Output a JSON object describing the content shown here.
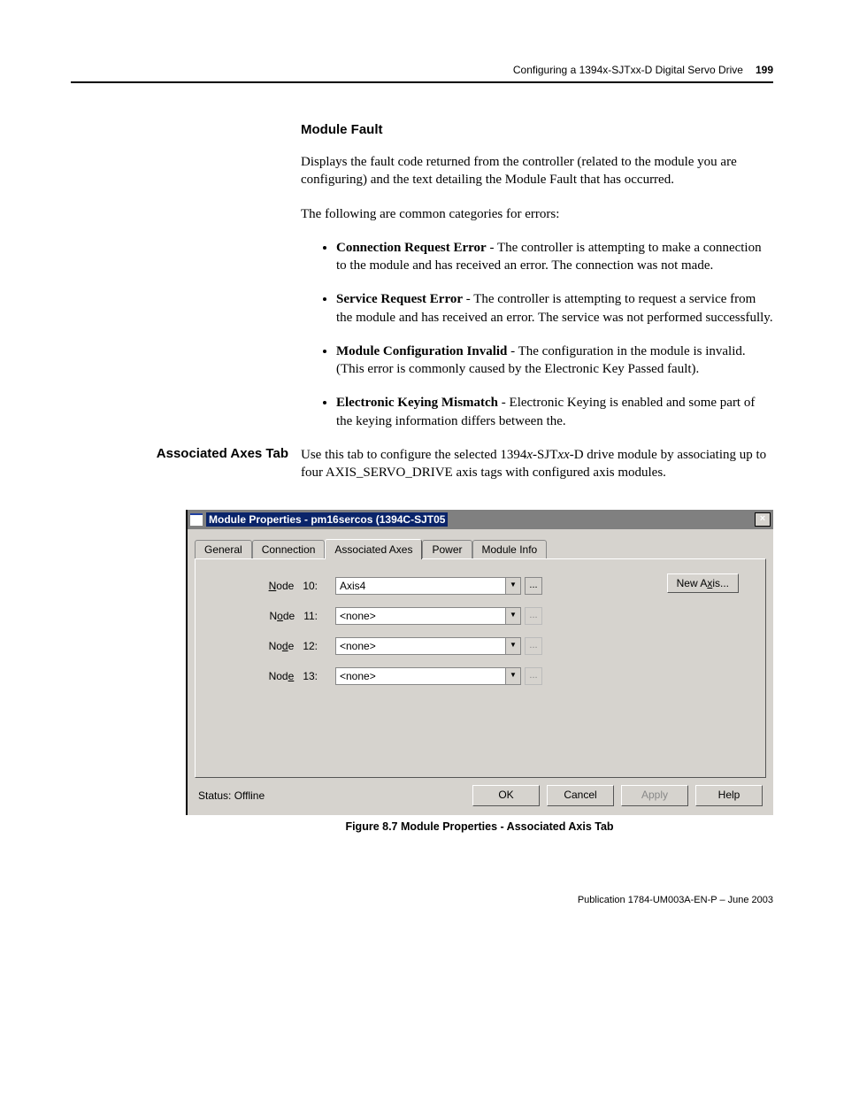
{
  "header": {
    "title": "Configuring a 1394x-SJTxx-D Digital Servo Drive",
    "pagenum": "199"
  },
  "section1": {
    "title": "Module Fault",
    "p1": "Displays the fault code returned from the controller (related to the module you are configuring) and the text detailing the Module Fault that has occurred.",
    "p2": "The following are common categories for errors:",
    "items": [
      {
        "term": "Connection Request Error",
        "desc": " - The controller is attempting to make a connection to the module and has received an error. The connection was not made."
      },
      {
        "term": "Service Request Error",
        "desc": " - The controller is attempting to request a service from the module and has received an error. The service was not performed successfully."
      },
      {
        "term": "Module Configuration Invalid",
        "desc": " - The configuration in the module is invalid. (This error is commonly caused by the Electronic Key Passed fault)."
      },
      {
        "term": "Electronic Keying Mismatch",
        "desc": " - Electronic Keying is enabled and some part of the keying information differs between the."
      }
    ]
  },
  "section2": {
    "side": "Associated Axes Tab",
    "p_pre": "Use this tab to configure the selected 1394",
    "p_em1": "x",
    "p_mid": "-SJT",
    "p_em2": "xx",
    "p_post": "-D drive module by associating up to four AXIS_SERVO_DRIVE axis tags with configured axis modules."
  },
  "dialog": {
    "title": "Module Properties - pm16sercos (1394C-SJT05",
    "tabs": [
      "General",
      "Connection",
      "Associated Axes",
      "Power",
      "Module Info"
    ],
    "rows": [
      {
        "u": "N",
        "rest": "ode",
        "num": "10:",
        "value": "Axis4",
        "ellEnabled": true
      },
      {
        "u": "o",
        "pre": "N",
        "rest": "de",
        "num": "11:",
        "value": "<none>",
        "ellEnabled": false
      },
      {
        "u": "d",
        "pre": "No",
        "rest": "e",
        "num": "12:",
        "value": "<none>",
        "ellEnabled": false
      },
      {
        "u": "e",
        "pre": "Nod",
        "rest": "",
        "num": "13:",
        "value": "<none>",
        "ellEnabled": false
      }
    ],
    "newAxis": {
      "pre": "New A",
      "u": "x",
      "post": "is..."
    },
    "status": "Status:  Offline",
    "buttons": [
      {
        "label": "OK",
        "disabled": false
      },
      {
        "label": "Cancel",
        "disabled": false
      },
      {
        "label": "Apply",
        "disabled": true
      },
      {
        "label": "Help",
        "disabled": false
      }
    ]
  },
  "figcaption": "Figure 8.7 Module Properties - Associated Axis Tab",
  "footer": "Publication 1784-UM003A-EN-P – June 2003"
}
